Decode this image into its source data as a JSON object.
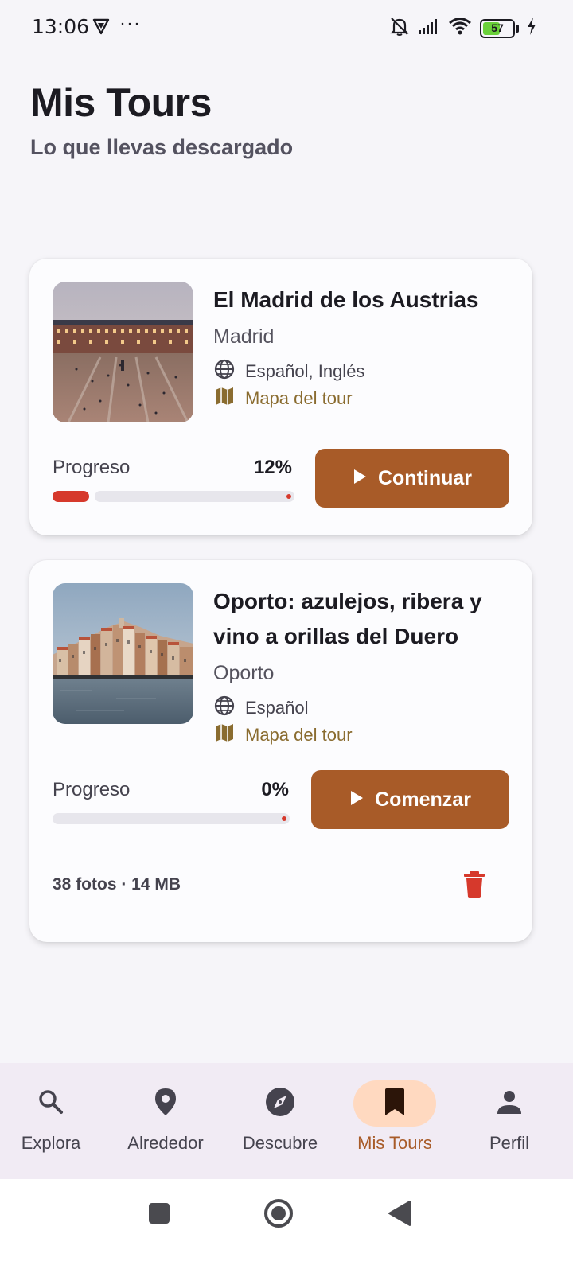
{
  "status_bar": {
    "time": "13:06",
    "dots": "···",
    "battery": "57"
  },
  "header": {
    "title": "Mis Tours",
    "subtitle": "Lo que llevas descargado"
  },
  "tours": [
    {
      "title": "El Madrid de los Austrias",
      "city": "Madrid",
      "languages": "Español, Inglés",
      "map_link": "Mapa del tour",
      "progress_label": "Progreso",
      "progress_text": "12%",
      "progress_value": 0.12,
      "action_label": "Continuar"
    },
    {
      "title": "Oporto: azulejos, ribera y vino a orillas del Duero",
      "city": "Oporto",
      "languages": "Español",
      "map_link": "Mapa del tour",
      "progress_label": "Progreso",
      "progress_text": "0%",
      "progress_value": 0,
      "action_label": "Comenzar",
      "footer": "38 fotos · 14 MB"
    }
  ],
  "bottom_nav": {
    "items": [
      {
        "label": "Explora",
        "icon": "search-icon"
      },
      {
        "label": "Alrededor",
        "icon": "location-pin-icon"
      },
      {
        "label": "Descubre",
        "icon": "compass-icon"
      },
      {
        "label": "Mis Tours",
        "icon": "bookmark-icon",
        "active": true
      },
      {
        "label": "Perfil",
        "icon": "person-icon"
      }
    ]
  },
  "colors": {
    "accent": "#a85b28",
    "active_pill": "#ffd9c0",
    "progress": "#d6392c",
    "map_link": "#8a6c30"
  }
}
